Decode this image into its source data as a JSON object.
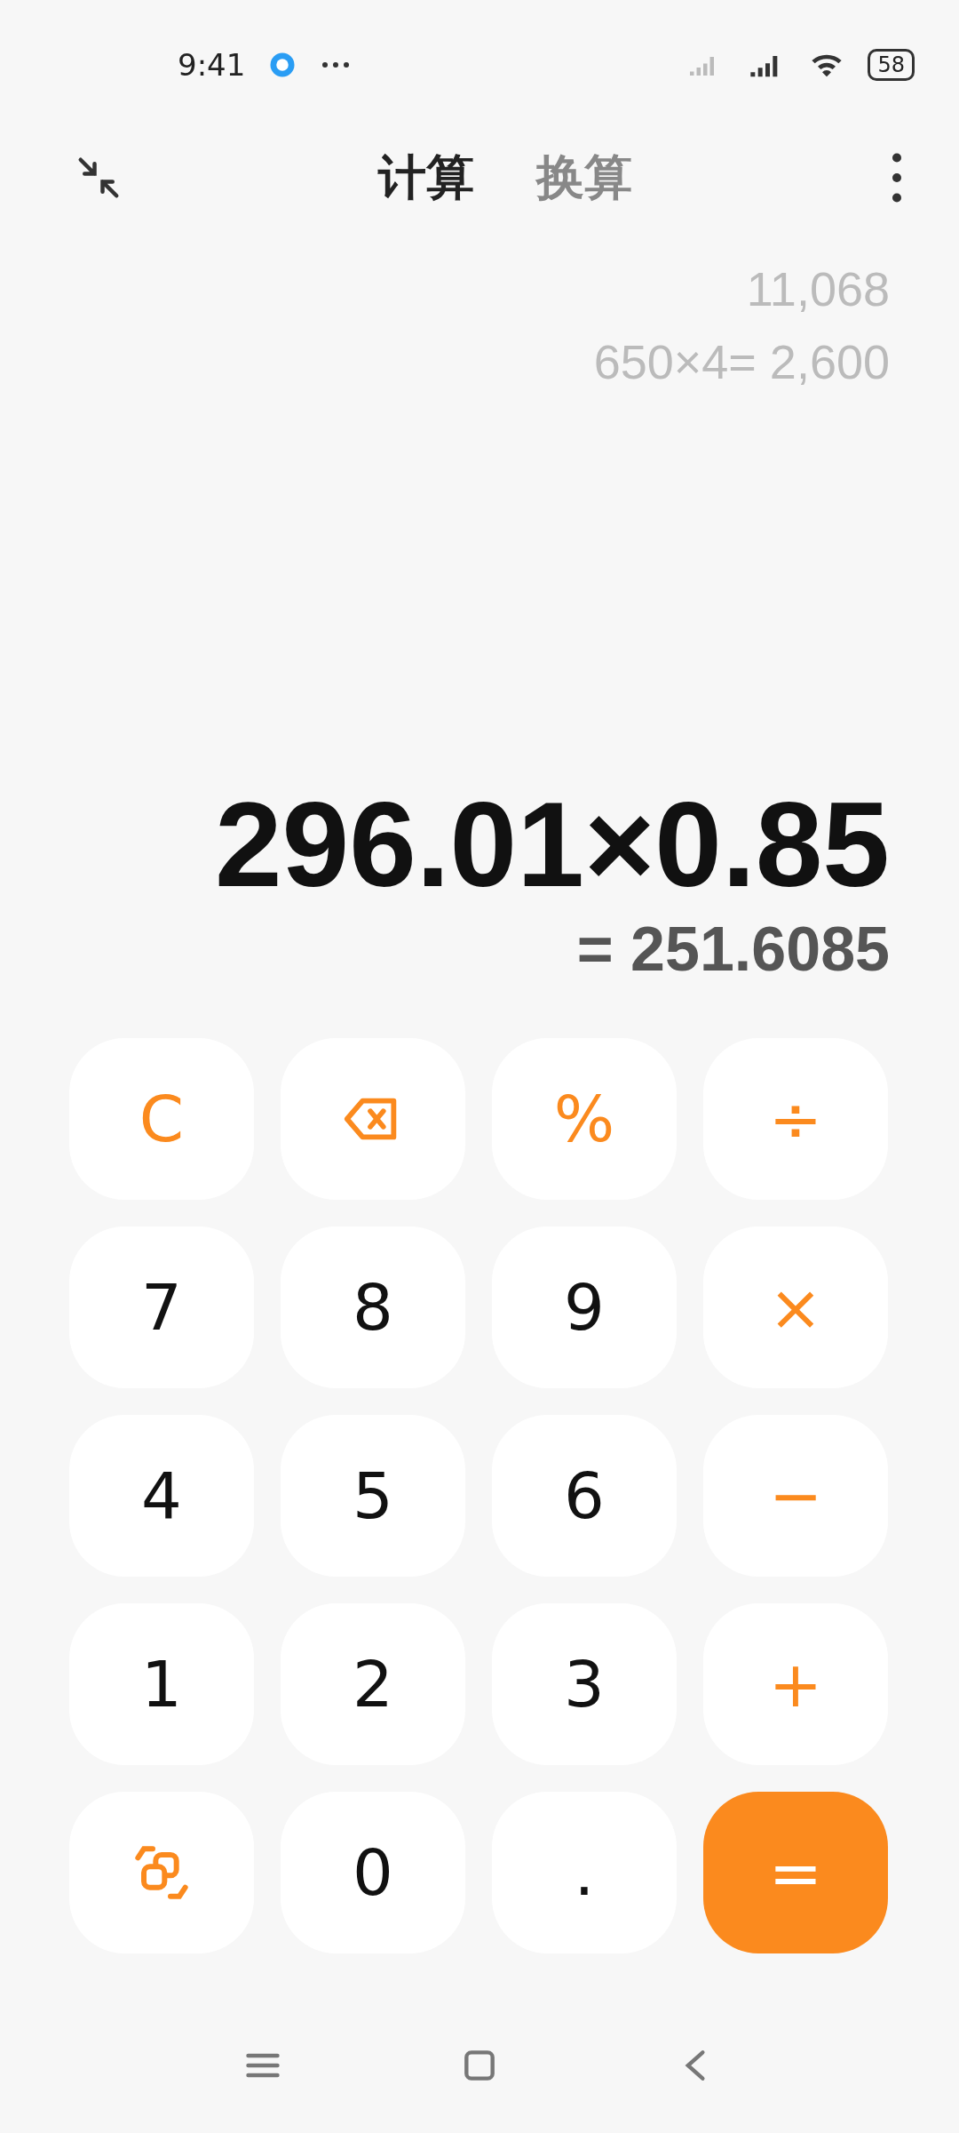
{
  "status_bar": {
    "time": "9:41",
    "battery": "58"
  },
  "tabs": [
    {
      "label": "计算",
      "selected": true
    },
    {
      "label": "换算",
      "selected": false
    }
  ],
  "history": [
    "11,068",
    "650×4= 2,600"
  ],
  "expression": "296.01×0.85",
  "result": "= 251.6085",
  "keys": [
    {
      "kind": "operator",
      "label": "C"
    },
    {
      "kind": "backspace"
    },
    {
      "kind": "operator",
      "label": "%"
    },
    {
      "kind": "operator",
      "label": "÷"
    },
    {
      "kind": "digit",
      "label": "7"
    },
    {
      "kind": "digit",
      "label": "8"
    },
    {
      "kind": "digit",
      "label": "9"
    },
    {
      "kind": "operator",
      "label": "×"
    },
    {
      "kind": "digit",
      "label": "4"
    },
    {
      "kind": "digit",
      "label": "5"
    },
    {
      "kind": "digit",
      "label": "6"
    },
    {
      "kind": "operator",
      "label": "−"
    },
    {
      "kind": "digit",
      "label": "1"
    },
    {
      "kind": "digit",
      "label": "2"
    },
    {
      "kind": "digit",
      "label": "3"
    },
    {
      "kind": "operator",
      "label": "+"
    },
    {
      "kind": "swap"
    },
    {
      "kind": "digit",
      "label": "0"
    },
    {
      "kind": "digit",
      "label": "."
    },
    {
      "kind": "equals",
      "label": "="
    }
  ]
}
